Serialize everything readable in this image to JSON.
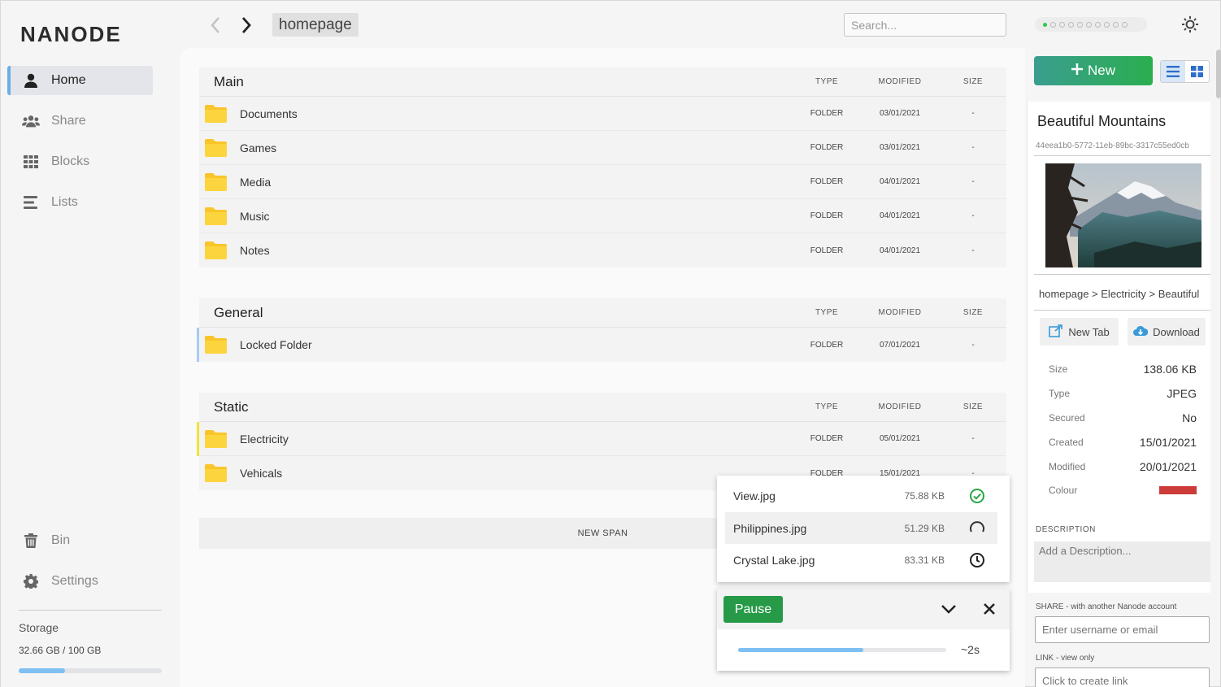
{
  "app": {
    "logo": "NANODE"
  },
  "sidebar": {
    "items": [
      {
        "label": "Home",
        "icon": "user-icon",
        "active": true
      },
      {
        "label": "Share",
        "icon": "users-icon"
      },
      {
        "label": "Blocks",
        "icon": "grid-icon"
      },
      {
        "label": "Lists",
        "icon": "list-icon"
      }
    ],
    "bottom_items": [
      {
        "label": "Bin",
        "icon": "trash-icon"
      },
      {
        "label": "Settings",
        "icon": "gear-icon"
      }
    ],
    "storage": {
      "title": "Storage",
      "value": "32.66 GB / 100 GB",
      "used_fraction": 0.3266
    }
  },
  "topbar": {
    "breadcrumb": "homepage",
    "search_placeholder": "Search...",
    "peers": {
      "online": 1,
      "total": 10,
      "online_color": "#2ecc40"
    }
  },
  "columns": {
    "type": "TYPE",
    "modified": "MODIFIED",
    "size": "SIZE"
  },
  "sections": [
    {
      "title": "Main",
      "rows": [
        {
          "name": "Documents",
          "type": "FOLDER",
          "modified": "03/01/2021",
          "size": "-"
        },
        {
          "name": "Games",
          "type": "FOLDER",
          "modified": "03/01/2021",
          "size": "-"
        },
        {
          "name": "Media",
          "type": "FOLDER",
          "modified": "04/01/2021",
          "size": "-"
        },
        {
          "name": "Music",
          "type": "FOLDER",
          "modified": "04/01/2021",
          "size": "-"
        },
        {
          "name": "Notes",
          "type": "FOLDER",
          "modified": "04/01/2021",
          "size": "-"
        }
      ]
    },
    {
      "title": "General",
      "rows": [
        {
          "name": "Locked Folder",
          "type": "FOLDER",
          "modified": "07/01/2021",
          "size": "-"
        }
      ]
    },
    {
      "title": "Static",
      "rows": [
        {
          "name": "Electricity",
          "type": "FOLDER",
          "modified": "05/01/2021",
          "size": "-"
        },
        {
          "name": "Vehicals",
          "type": "FOLDER",
          "modified": "15/01/2021",
          "size": "-"
        }
      ]
    }
  ],
  "new_span_label": "NEW SPAN",
  "uploads": {
    "items": [
      {
        "name": "View.jpg",
        "size": "75.88 KB",
        "status": "check-circle-icon"
      },
      {
        "name": "Philippines.jpg",
        "size": "51.29 KB",
        "status": "loading-spinner-icon"
      },
      {
        "name": "Crystal Lake.jpg",
        "size": "83.31 KB",
        "status": "clock-icon"
      }
    ],
    "pause_label": "Pause",
    "progress_fraction": 0.6,
    "eta": "~2s"
  },
  "actions": {
    "new_label": "New"
  },
  "details": {
    "title": "Beautiful Mountains",
    "id": "44eea1b0-5772-11eb-89bc-3317c55ed0cb",
    "path": "homepage > Electricity > Beautiful",
    "new_tab_label": "New Tab",
    "download_label": "Download",
    "meta": [
      {
        "key": "Size",
        "value": "138.06 KB"
      },
      {
        "key": "Type",
        "value": "JPEG"
      },
      {
        "key": "Secured",
        "value": "No"
      },
      {
        "key": "Created",
        "value": "15/01/2021"
      },
      {
        "key": "Modified",
        "value": "20/01/2021"
      }
    ],
    "colour_key": "Colour",
    "colour_value": "#cc3a3a",
    "description_label": "DESCRIPTION",
    "description_placeholder": "Add a Description...",
    "share_label": "SHARE - with another Nanode account",
    "share_placeholder": "Enter username or email",
    "link_label": "LINK - view only",
    "link_placeholder": "Click to create link"
  }
}
